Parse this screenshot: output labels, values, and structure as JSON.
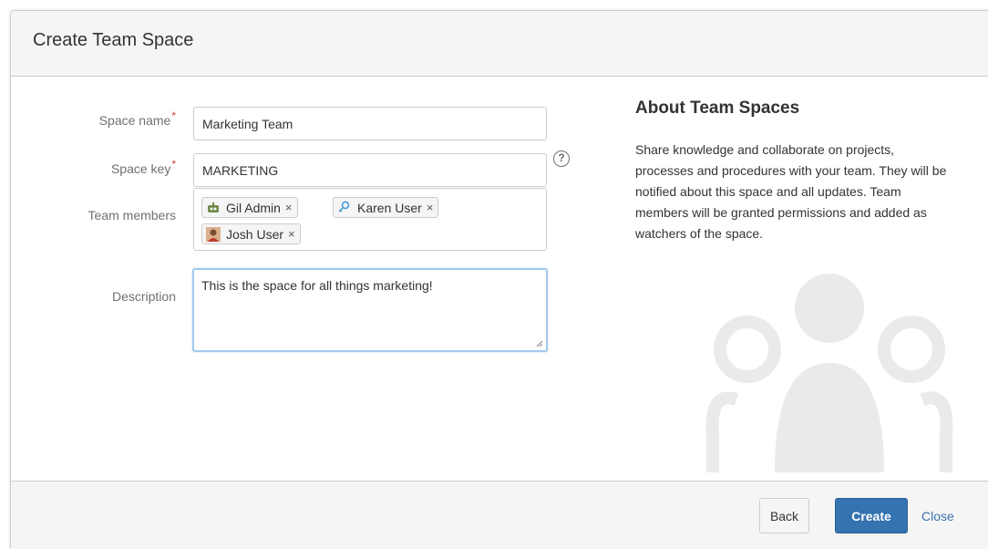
{
  "dialog": {
    "title": "Create Team Space"
  },
  "form": {
    "space_name": {
      "label": "Space name",
      "required_mark": "*",
      "value": "Marketing Team"
    },
    "space_key": {
      "label": "Space key",
      "required_mark": "*",
      "value": "MARKETING",
      "help_icon": "question-circle-icon"
    },
    "team_members": {
      "label": "Team members",
      "members": [
        {
          "name": "Gil Admin",
          "remove": "×"
        },
        {
          "name": "Karen User",
          "remove": "×"
        },
        {
          "name": "Josh User",
          "remove": "×"
        }
      ]
    },
    "description": {
      "label": "Description",
      "value": "This is the space for all things marketing!"
    }
  },
  "about": {
    "title": "About Team Spaces",
    "text": "Share knowledge and collaborate on projects, processes and procedures with your team. They will be notified about this space and all updates. Team members will be granted permissions and added as watchers of the space."
  },
  "footer": {
    "back_label": "Back",
    "create_label": "Create",
    "close_label": "Close"
  },
  "colors": {
    "primary": "#3572b0",
    "required": "#d04437",
    "focus_border": "#a5c8ef",
    "link": "#3b73af"
  }
}
